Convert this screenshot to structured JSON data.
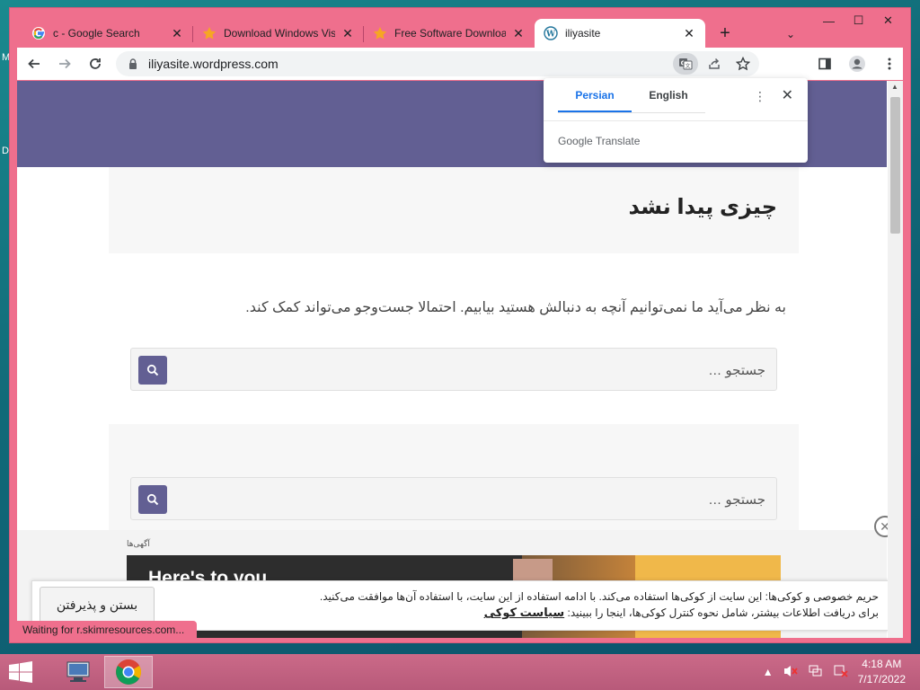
{
  "desktop": {
    "left_glyph_1": "M",
    "left_glyph_2": "D"
  },
  "browser": {
    "tabs": [
      {
        "title": "c - Google Search",
        "icon": "google-g-icon"
      },
      {
        "title": "Download Windows Vis",
        "icon": "star-icon"
      },
      {
        "title": "Free Software Downloa",
        "icon": "star-icon"
      },
      {
        "title": "iliyasite",
        "icon": "wordpress-icon"
      }
    ],
    "new_tab_symbol": "+",
    "tab_search_symbol": "⌄",
    "window_controls": {
      "minimize": "—",
      "maximize": "☐",
      "close": "✕"
    },
    "url": "iliyasite.wordpress.com"
  },
  "translate_popup": {
    "tab_selected": "Persian",
    "tab_other": "English",
    "more_symbol": "⋮",
    "close_symbol": "✕",
    "brand": "Google Translate"
  },
  "page": {
    "not_found_title": "چیزی پیدا نشد",
    "description": "به نظر می‌آید ما نمی‌توانیم آنچه به دنبالش هستید بیابیم. احتمالا جست‌وجو می‌تواند کمک کند.",
    "search_placeholder_1": "جستجو …",
    "search_placeholder_2": "جستجو …"
  },
  "ad": {
    "label": "آگهی‌ها",
    "headline": "Here's to you.",
    "close_symbol": "✕"
  },
  "cookie_bar": {
    "line1": "حریم خصوصی و کوکی‌ها: این سایت از کوکی‌ها استفاده می‌کند. با ادامه استفاده از این سایت، با استفاده آن‌ها موافقت می‌کنید.",
    "line2": "برای دریافت اطلاعات بیشتر، شامل نحوه کنترل کوکی‌ها، اینجا را ببینید:",
    "link": "سیاست کوکی",
    "button": "بستن و پذیرفتن"
  },
  "status_text": "Waiting for r.skimresources.com...",
  "taskbar": {
    "time": "4:18 AM",
    "date": "7/17/2022"
  },
  "colors": {
    "frame": "#ef6f8d",
    "header_band": "#625f93",
    "accent_blue": "#1a73e8"
  }
}
